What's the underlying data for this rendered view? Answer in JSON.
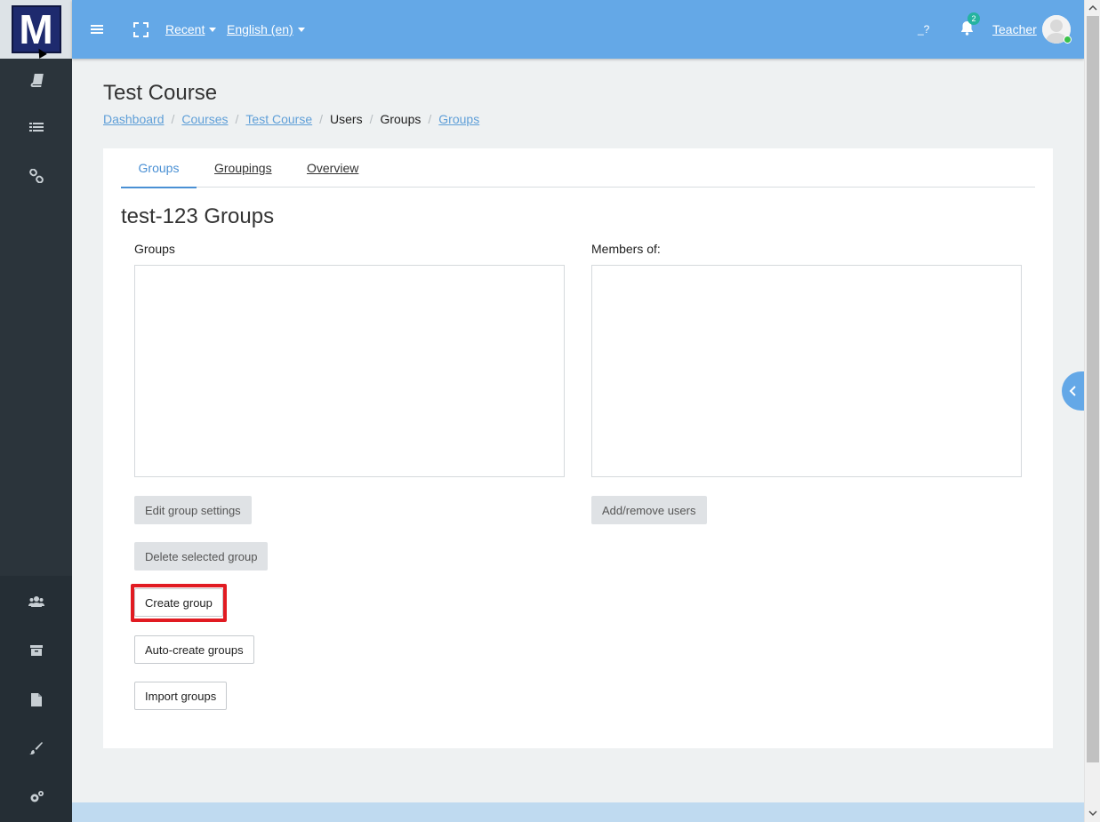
{
  "topbar": {
    "recent_label": "Recent",
    "language_label": "English (en)",
    "help_label": "_?",
    "notification_count": "2",
    "user_name": "Teacher"
  },
  "logo": {
    "letter": "M"
  },
  "page": {
    "title": "Test Course",
    "breadcrumb": [
      {
        "label": "Dashboard",
        "link": true
      },
      {
        "label": "Courses",
        "link": true
      },
      {
        "label": "Test Course",
        "link": true
      },
      {
        "label": "Users",
        "link": false
      },
      {
        "label": "Groups",
        "link": false
      },
      {
        "label": "Groups",
        "link": true
      }
    ]
  },
  "tabs": [
    {
      "label": "Groups",
      "active": true
    },
    {
      "label": "Groupings",
      "active": false
    },
    {
      "label": "Overview",
      "active": false
    }
  ],
  "main": {
    "heading": "test-123 Groups",
    "groups_label": "Groups",
    "members_label": "Members of:",
    "buttons": {
      "edit_group_settings": "Edit group settings",
      "delete_selected_group": "Delete selected group",
      "create_group": "Create group",
      "auto_create_groups": "Auto-create groups",
      "import_groups": "Import groups",
      "add_remove_users": "Add/remove users"
    }
  },
  "rail_icons": [
    "book-icon",
    "list-icon",
    "link-icon",
    "users-icon",
    "archive-icon",
    "file-icon",
    "brush-icon",
    "cogs-icon"
  ],
  "colors": {
    "topbar": "#64a8e7",
    "rail": "#252e35",
    "active_tab": "#4a90d4",
    "highlight": "#e11b22",
    "notification_badge": "#25b3a0"
  }
}
